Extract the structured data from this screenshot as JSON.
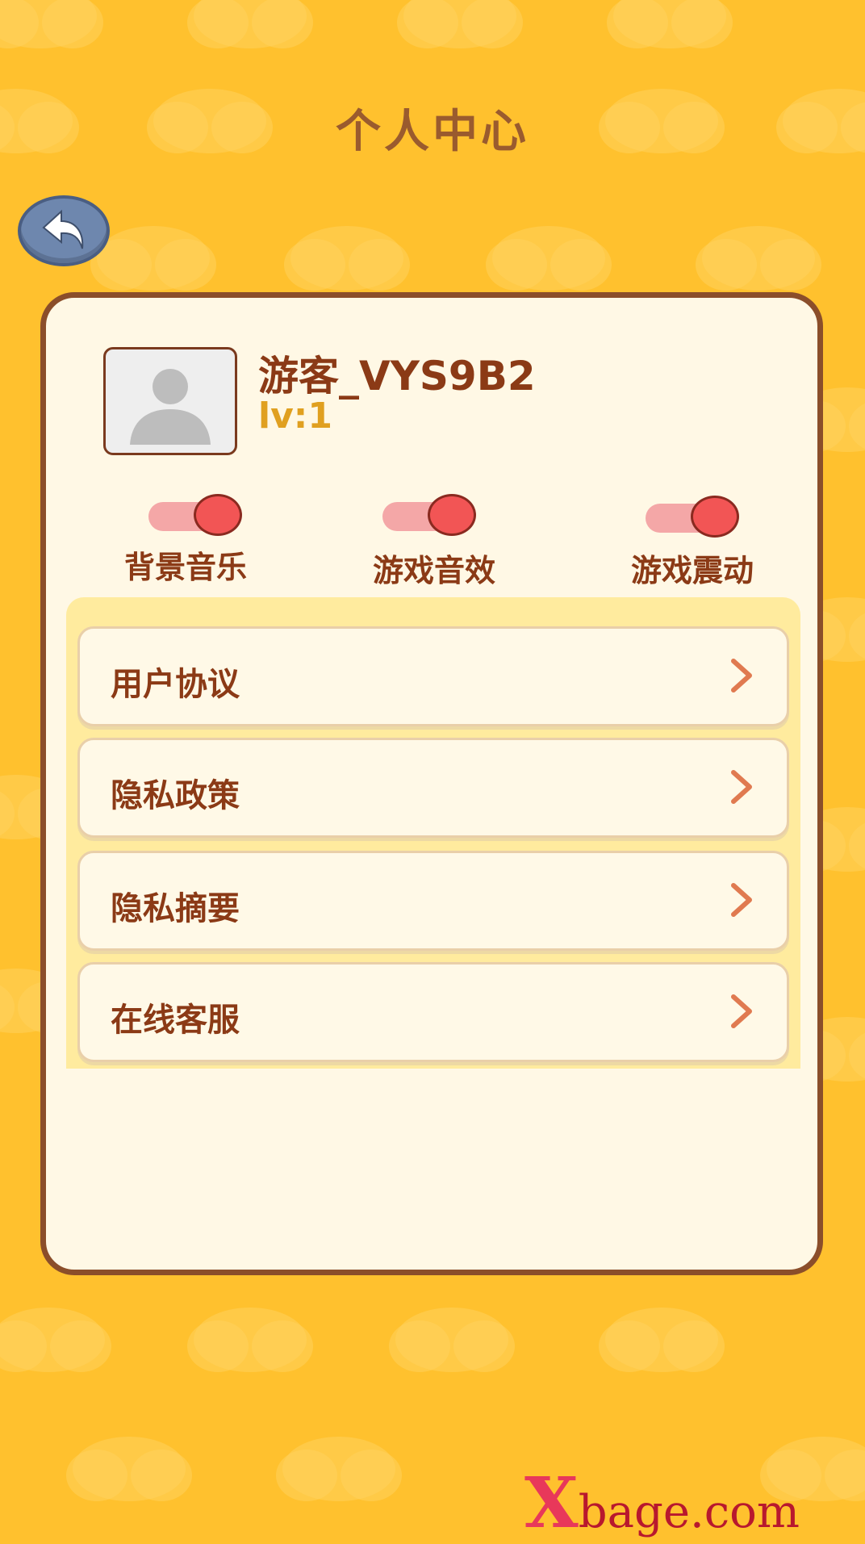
{
  "header": {
    "title": "个人中心"
  },
  "profile": {
    "username": "游客_VYS9B2",
    "level": "lv:1"
  },
  "settings": {
    "toggles": [
      {
        "label": "背景音乐",
        "on": true
      },
      {
        "label": "游戏音效",
        "on": true
      },
      {
        "label": "游戏震动",
        "on": true
      }
    ]
  },
  "menu": {
    "items": [
      {
        "label": "用户协议"
      },
      {
        "label": "隐私政策"
      },
      {
        "label": "隐私摘要"
      },
      {
        "label": "在线客服"
      }
    ]
  },
  "watermark": {
    "x": "X",
    "rest": "bage.com"
  },
  "colors": {
    "background": "#FFC12E",
    "panel": "#FFF8E5",
    "panel_border": "#8B4E2A",
    "text_brown": "#8B3A16",
    "level_gold": "#E0A020",
    "toggle_knob": "#F25555",
    "toggle_track": "#F4A7A7",
    "back_button": "#6E87AE"
  },
  "icons": {
    "back": "back-arrow-icon",
    "avatar": "user-silhouette-icon",
    "chevron": "chevron-right-icon"
  }
}
